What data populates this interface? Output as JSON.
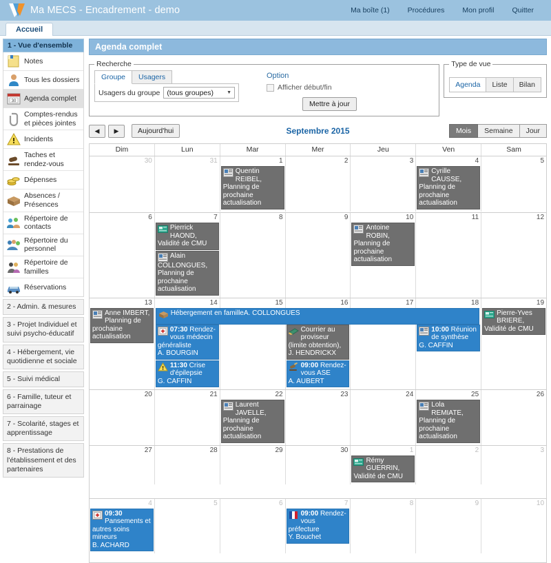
{
  "app": {
    "title": "Ma MECS - Encadrement - demo",
    "logo_icon": "v-logo-icon"
  },
  "topnav": [
    {
      "label": "Ma boîte (1)",
      "name": "nav-ma-boite"
    },
    {
      "label": "Procédures",
      "name": "nav-procedures"
    },
    {
      "label": "Mon profil",
      "name": "nav-mon-profil"
    },
    {
      "label": "Quitter",
      "name": "nav-quitter"
    }
  ],
  "tabs": [
    {
      "label": "Accueil",
      "active": true
    }
  ],
  "sidebar": {
    "section1_title": "1 - Vue d'ensemble",
    "items": [
      {
        "label": "Notes",
        "icon": "notes-icon",
        "active": false
      },
      {
        "label": "Tous les dossiers",
        "icon": "user-folder-icon",
        "active": false
      },
      {
        "label": "Agenda complet",
        "icon": "calendar-icon",
        "active": true
      },
      {
        "label": "Comptes-rendus et pièces jointes",
        "icon": "paperclip-icon",
        "active": false
      },
      {
        "label": "Incidents",
        "icon": "warning-icon",
        "active": false
      },
      {
        "label": "Taches et rendez-vous",
        "icon": "gavel-icon",
        "active": false
      },
      {
        "label": "Dépenses",
        "icon": "coins-icon",
        "active": false
      },
      {
        "label": "Absences / Présences",
        "icon": "box-icon",
        "active": false
      },
      {
        "label": "Répertoire de contacts",
        "icon": "contacts-icon",
        "active": false
      },
      {
        "label": "Répertoire du personnel",
        "icon": "staff-icon",
        "active": false
      },
      {
        "label": "Répertoire de familles",
        "icon": "families-icon",
        "active": false
      },
      {
        "label": "Réservations",
        "icon": "car-icon",
        "active": false
      }
    ],
    "sections": [
      {
        "label": "2 - Admin. & mesures"
      },
      {
        "label": "3 - Projet Individuel et suivi psycho-éducatif"
      },
      {
        "label": "4 - Hébergement, vie quotidienne et sociale"
      },
      {
        "label": "5 - Suivi médical"
      },
      {
        "label": "6 - Famille, tuteur et parrainage"
      },
      {
        "label": "7 - Scolarité, stages et apprentissage"
      },
      {
        "label": "8 - Prestations de l'établissement et des partenaires"
      }
    ]
  },
  "panel": {
    "title": "Agenda complet",
    "recherche": {
      "legend": "Recherche",
      "tabs": [
        {
          "label": "Groupe",
          "selected": true
        },
        {
          "label": "Usagers",
          "selected": false
        }
      ],
      "select_label": "Usagers du groupe",
      "select_value": "(tous groupes)",
      "option_title": "Option",
      "checkbox_label": "Afficher début/fin",
      "checkbox_checked": false,
      "update_button": "Mettre à jour"
    },
    "typedevue": {
      "legend": "Type de vue",
      "buttons": [
        {
          "label": "Agenda",
          "selected": true
        },
        {
          "label": "Liste",
          "selected": false
        },
        {
          "label": "Bilan",
          "selected": false
        }
      ]
    }
  },
  "calendar": {
    "prev_label": "◀",
    "next_label": "▶",
    "today_label": "Aujourd'hui",
    "title": "Septembre 2015",
    "range_buttons": [
      {
        "label": "Mois",
        "selected": true
      },
      {
        "label": "Semaine",
        "selected": false
      },
      {
        "label": "Jour",
        "selected": false
      }
    ],
    "dow": [
      "Dim",
      "Lun",
      "Mar",
      "Mer",
      "Jeu",
      "Ven",
      "Sam"
    ],
    "weeks": [
      {
        "days": [
          {
            "num": "30",
            "other": true,
            "events": []
          },
          {
            "num": "31",
            "other": true,
            "events": []
          },
          {
            "num": "1",
            "other": false,
            "events": [
              {
                "style": "gray",
                "icon": "id-card-icon",
                "time": "",
                "text": "Quentin REIBEL, Planning de prochaine actualisation",
                "who": ""
              }
            ]
          },
          {
            "num": "2",
            "other": false,
            "events": []
          },
          {
            "num": "3",
            "other": false,
            "events": []
          },
          {
            "num": "4",
            "other": false,
            "events": [
              {
                "style": "gray",
                "icon": "id-card-icon",
                "time": "",
                "text": "Cyrille CAUSSE, Planning de prochaine actualisation",
                "who": ""
              }
            ]
          },
          {
            "num": "5",
            "other": false,
            "events": []
          }
        ]
      },
      {
        "days": [
          {
            "num": "6",
            "other": false,
            "events": []
          },
          {
            "num": "7",
            "other": false,
            "events": [
              {
                "style": "gray",
                "icon": "green-card-icon",
                "time": "",
                "text": "Pierrick HAOND, Validité de CMU",
                "who": ""
              },
              {
                "style": "gray",
                "icon": "id-card-icon",
                "time": "",
                "text": "Alain COLLONGUES, Planning de prochaine actualisation",
                "who": ""
              }
            ]
          },
          {
            "num": "8",
            "other": false,
            "events": []
          },
          {
            "num": "9",
            "other": false,
            "events": []
          },
          {
            "num": "10",
            "other": false,
            "events": [
              {
                "style": "gray",
                "icon": "id-card-icon",
                "time": "",
                "text": "Antoine ROBIN, Planning de prochaine actualisation",
                "who": ""
              }
            ]
          },
          {
            "num": "11",
            "other": false,
            "events": []
          },
          {
            "num": "12",
            "other": false,
            "events": []
          }
        ]
      },
      {
        "spanbar": {
          "title": "Hébergement en famille",
          "who": "A. COLLONGUES",
          "icon": "box-icon",
          "start_col": 1,
          "span_cols": 5
        },
        "days": [
          {
            "num": "13",
            "other": false,
            "events": [
              {
                "style": "gray",
                "icon": "id-card-icon",
                "time": "",
                "text": "Anne IMBERT, Planning de prochaine actualisation",
                "who": ""
              }
            ]
          },
          {
            "num": "14",
            "other": false,
            "pad": true,
            "events": [
              {
                "style": "blue",
                "icon": "medkit-icon",
                "time": "07:30",
                "text": "Rendez-vous médecin généraliste",
                "who": "A. BOURGIN"
              },
              {
                "style": "blue",
                "icon": "warning-icon",
                "time": "11:30",
                "text": "Crise d'épilepsie",
                "who": "G. CAFFIN"
              }
            ]
          },
          {
            "num": "15",
            "other": false,
            "pad": true,
            "events": []
          },
          {
            "num": "16",
            "other": false,
            "pad": true,
            "events": [
              {
                "style": "gray",
                "icon": "mail-icon",
                "time": "",
                "text": "Courrier au proviseur (limite obtention), J. HENDRICKX",
                "who": ""
              },
              {
                "style": "blue",
                "icon": "gavel-icon",
                "time": "09:00",
                "text": "Rendez-vous ASE",
                "who": "A. AUBERT"
              }
            ]
          },
          {
            "num": "17",
            "other": false,
            "pad": true,
            "events": []
          },
          {
            "num": "18",
            "other": false,
            "pad": true,
            "events": [
              {
                "style": "blue",
                "icon": "id-card-icon",
                "time": "10:00",
                "text": "Réunion de synthèse",
                "who": "G. CAFFIN"
              }
            ]
          },
          {
            "num": "19",
            "other": false,
            "events": [
              {
                "style": "gray",
                "icon": "green-card-icon",
                "time": "",
                "text": "Pierre-Yves BRIERE, Validité de CMU",
                "who": ""
              }
            ]
          }
        ]
      },
      {
        "days": [
          {
            "num": "20",
            "other": false,
            "events": []
          },
          {
            "num": "21",
            "other": false,
            "events": []
          },
          {
            "num": "22",
            "other": false,
            "events": [
              {
                "style": "gray",
                "icon": "id-card-icon",
                "time": "",
                "text": "Laurent JAVELLE, Planning de prochaine actualisation",
                "who": ""
              }
            ]
          },
          {
            "num": "23",
            "other": false,
            "events": []
          },
          {
            "num": "24",
            "other": false,
            "events": []
          },
          {
            "num": "25",
            "other": false,
            "events": [
              {
                "style": "gray",
                "icon": "id-card-icon",
                "time": "",
                "text": "Lola REMIATE, Planning de prochaine actualisation",
                "who": ""
              }
            ]
          },
          {
            "num": "26",
            "other": false,
            "events": []
          }
        ]
      },
      {
        "days": [
          {
            "num": "27",
            "other": false,
            "events": []
          },
          {
            "num": "28",
            "other": false,
            "events": []
          },
          {
            "num": "29",
            "other": false,
            "events": []
          },
          {
            "num": "30",
            "other": false,
            "events": []
          },
          {
            "num": "1",
            "other": true,
            "events": [
              {
                "style": "gray",
                "icon": "green-card-icon",
                "time": "",
                "text": "Rémy GUERRIN, Validité de CMU",
                "who": ""
              }
            ]
          },
          {
            "num": "2",
            "other": true,
            "events": []
          },
          {
            "num": "3",
            "other": true,
            "events": []
          }
        ]
      },
      {
        "days": [
          {
            "num": "4",
            "other": true,
            "events": [
              {
                "style": "blue",
                "icon": "medkit-icon",
                "time": "09:30",
                "text": "Pansements et autres soins mineurs",
                "who": "B. ACHARD"
              }
            ]
          },
          {
            "num": "5",
            "other": true,
            "events": []
          },
          {
            "num": "6",
            "other": true,
            "events": []
          },
          {
            "num": "7",
            "other": true,
            "events": [
              {
                "style": "blue",
                "icon": "flag-fr-icon",
                "time": "09:00",
                "text": "Rendez-vous préfecture",
                "who": "Y. Bouchet"
              }
            ]
          },
          {
            "num": "8",
            "other": true,
            "events": []
          },
          {
            "num": "9",
            "other": true,
            "events": []
          },
          {
            "num": "10",
            "other": true,
            "events": []
          }
        ]
      }
    ]
  },
  "colors": {
    "header_blue": "#9bc2df",
    "panel_blue": "#8db9dd",
    "event_gray": "#6f6f6f",
    "event_blue": "#2f83c9",
    "link_blue": "#1a64a5"
  }
}
